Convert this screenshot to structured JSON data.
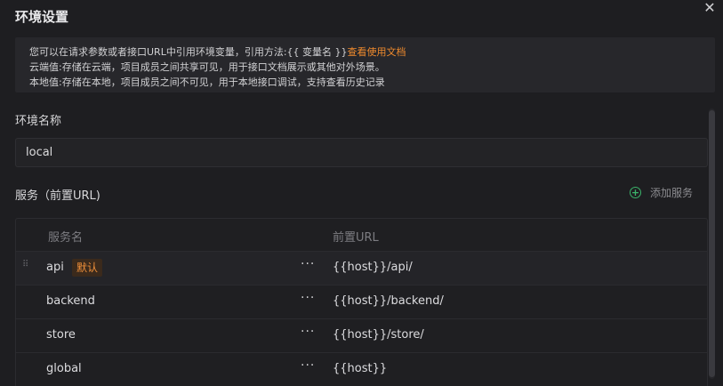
{
  "dialog": {
    "title": "环境设置",
    "close_glyph": "✕"
  },
  "notice": {
    "line1_prefix": "您可以在请求参数或者接口URL中引用环境变量，引用方法:{{ 变量名 }}",
    "line1_link": "查看使用文档",
    "line2": "云端值:存储在云端，项目成员之间共享可见，用于接口文档展示或其他对外场景。",
    "line3": "本地值:存储在本地，项目成员之间不可见，用于本地接口调试，支持查看历史记录",
    "link_color": "#ee8a2d"
  },
  "env": {
    "label": "环境名称",
    "value": "local"
  },
  "services": {
    "label": "服务（前置URL)",
    "add_label": "添加服务",
    "add_icon": "plus-circle-icon",
    "columns": [
      "服务名",
      "前置URL"
    ],
    "rows": [
      {
        "name": "api",
        "badge": "默认",
        "url": "{{host}}/api/"
      },
      {
        "name": "backend",
        "url": "{{host}}/backend/"
      },
      {
        "name": "store",
        "url": "{{host}}/store/"
      },
      {
        "name": "global",
        "url": "{{host}}"
      }
    ],
    "more_glyph": "···",
    "drag_glyph": "⠿"
  },
  "colors": {
    "accent": "#ee8a2d",
    "success": "#3bb36a",
    "background": "#1e1e21"
  }
}
